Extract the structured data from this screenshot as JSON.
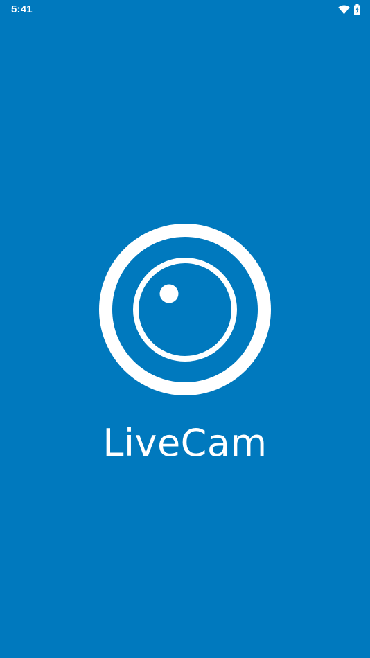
{
  "status_bar": {
    "time": "5:41",
    "icons": [
      "wifi-icon",
      "battery-charging-icon"
    ]
  },
  "splash": {
    "logo_icon": "camera-lens-icon",
    "app_name": "LiveCam"
  },
  "colors": {
    "background": "#0079be",
    "foreground": "#ffffff"
  }
}
